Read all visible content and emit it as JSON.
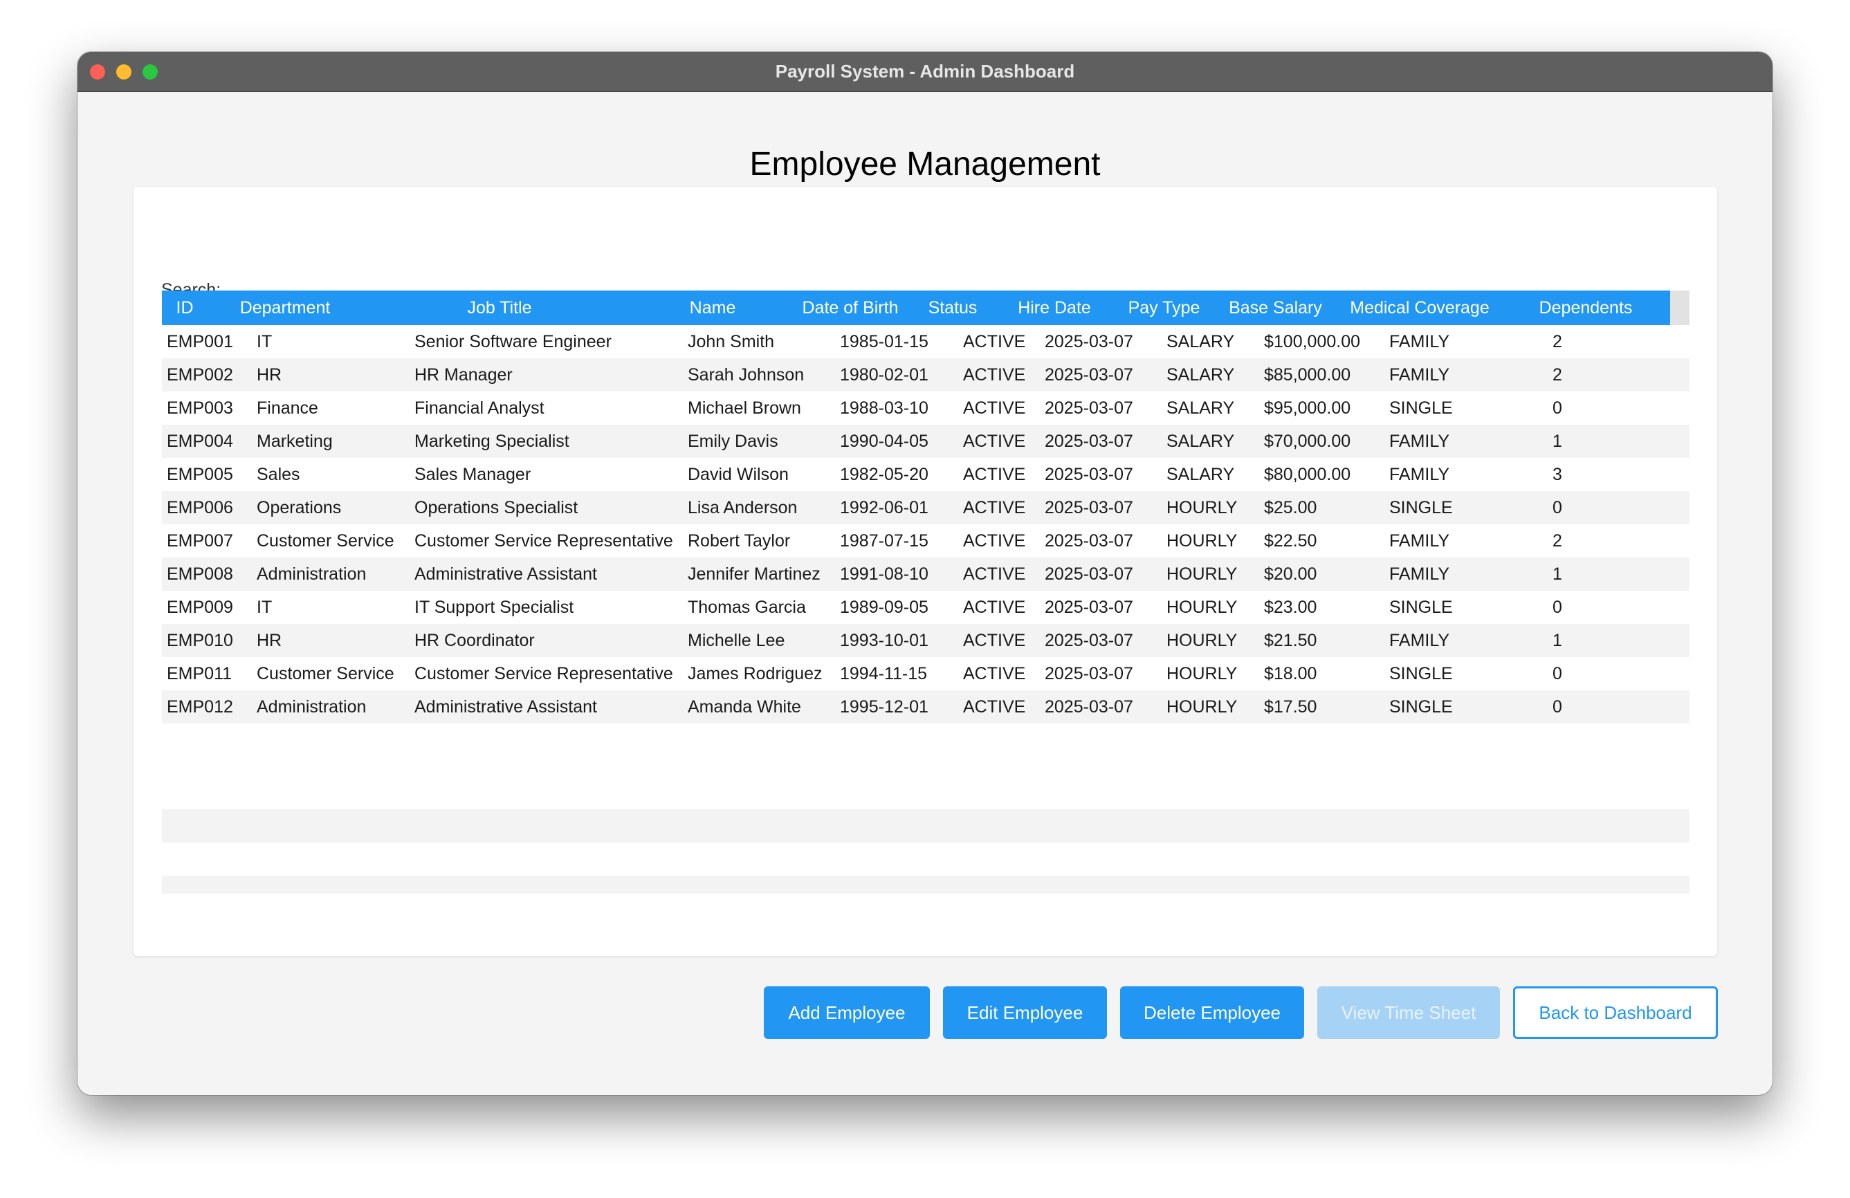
{
  "window": {
    "title": "Payroll System - Admin Dashboard"
  },
  "page": {
    "title": "Employee Management"
  },
  "search": {
    "label": "Search:",
    "value": "",
    "placeholder": ""
  },
  "table": {
    "columns": [
      "ID",
      "Department",
      "Job Title",
      "Name",
      "Date of Birth",
      "Status",
      "Hire Date",
      "Pay Type",
      "Base Salary",
      "Medical Coverage",
      "Dependents"
    ],
    "rows": [
      [
        "EMP001",
        "IT",
        "Senior Software Engineer",
        "John Smith",
        "1985-01-15",
        "ACTIVE",
        "2025-03-07",
        "SALARY",
        "$100,000.00",
        "FAMILY",
        "2"
      ],
      [
        "EMP002",
        "HR",
        "HR Manager",
        "Sarah Johnson",
        "1980-02-01",
        "ACTIVE",
        "2025-03-07",
        "SALARY",
        "$85,000.00",
        "FAMILY",
        "2"
      ],
      [
        "EMP003",
        "Finance",
        "Financial Analyst",
        "Michael Brown",
        "1988-03-10",
        "ACTIVE",
        "2025-03-07",
        "SALARY",
        "$95,000.00",
        "SINGLE",
        "0"
      ],
      [
        "EMP004",
        "Marketing",
        "Marketing Specialist",
        "Emily Davis",
        "1990-04-05",
        "ACTIVE",
        "2025-03-07",
        "SALARY",
        "$70,000.00",
        "FAMILY",
        "1"
      ],
      [
        "EMP005",
        "Sales",
        "Sales Manager",
        "David Wilson",
        "1982-05-20",
        "ACTIVE",
        "2025-03-07",
        "SALARY",
        "$80,000.00",
        "FAMILY",
        "3"
      ],
      [
        "EMP006",
        "Operations",
        "Operations Specialist",
        "Lisa Anderson",
        "1992-06-01",
        "ACTIVE",
        "2025-03-07",
        "HOURLY",
        "$25.00",
        "SINGLE",
        "0"
      ],
      [
        "EMP007",
        "Customer Service",
        "Customer Service Representative",
        "Robert Taylor",
        "1987-07-15",
        "ACTIVE",
        "2025-03-07",
        "HOURLY",
        "$22.50",
        "FAMILY",
        "2"
      ],
      [
        "EMP008",
        "Administration",
        "Administrative Assistant",
        "Jennifer Martinez",
        "1991-08-10",
        "ACTIVE",
        "2025-03-07",
        "HOURLY",
        "$20.00",
        "FAMILY",
        "1"
      ],
      [
        "EMP009",
        "IT",
        "IT Support Specialist",
        "Thomas Garcia",
        "1989-09-05",
        "ACTIVE",
        "2025-03-07",
        "HOURLY",
        "$23.00",
        "SINGLE",
        "0"
      ],
      [
        "EMP010",
        "HR",
        "HR Coordinator",
        "Michelle Lee",
        "1993-10-01",
        "ACTIVE",
        "2025-03-07",
        "HOURLY",
        "$21.50",
        "FAMILY",
        "1"
      ],
      [
        "EMP011",
        "Customer Service",
        "Customer Service Representative",
        "James Rodriguez",
        "1994-11-15",
        "ACTIVE",
        "2025-03-07",
        "HOURLY",
        "$18.00",
        "SINGLE",
        "0"
      ],
      [
        "EMP012",
        "Administration",
        "Administrative Assistant",
        "Amanda White",
        "1995-12-01",
        "ACTIVE",
        "2025-03-07",
        "HOURLY",
        "$17.50",
        "SINGLE",
        "0"
      ]
    ]
  },
  "buttons": {
    "add": "Add Employee",
    "edit": "Edit Employee",
    "delete": "Delete Employee",
    "timesheet": "View Time Sheet",
    "back": "Back to Dashboard"
  },
  "colors": {
    "accent": "#2196f3",
    "accent_disabled": "#a6d2f6",
    "titlebar": "#5f5f5f",
    "close": "#fe5f57",
    "minimize": "#febc2e",
    "zoom": "#28c840"
  }
}
